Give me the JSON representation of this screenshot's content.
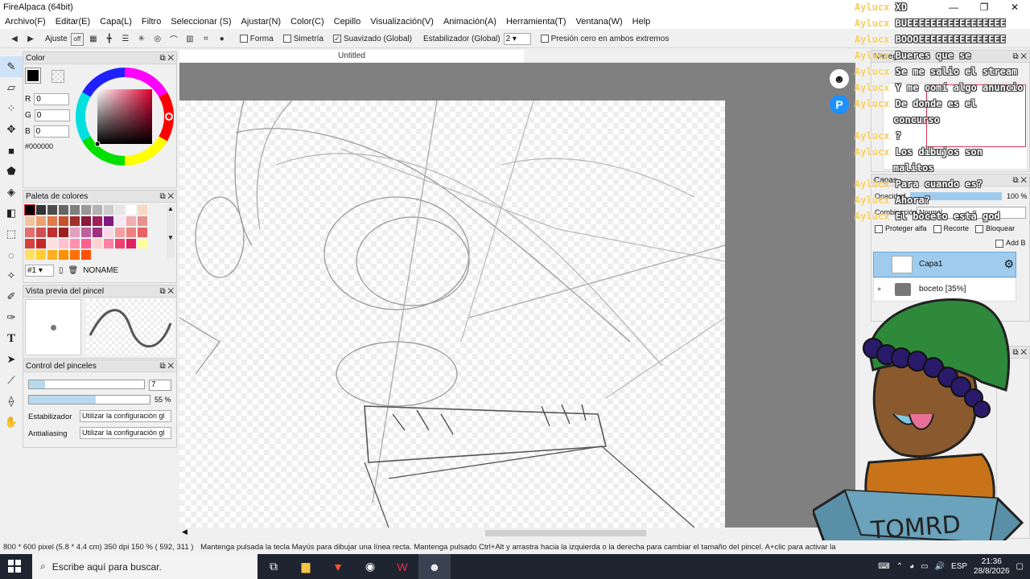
{
  "window": {
    "title": "FireAlpaca (64bit)",
    "controls": [
      "—",
      "❐",
      "✕"
    ]
  },
  "menu": [
    "Archivo(F)",
    "Editar(E)",
    "Capa(L)",
    "Filtro",
    "Seleccionar (S)",
    "Ajustar(N)",
    "Color(C)",
    "Cepillo",
    "Visualización(V)",
    "Animación(A)",
    "Herramienta(T)",
    "Ventana(W)",
    "Help"
  ],
  "toolbar": {
    "ajuste": "Ajuste",
    "forma": "Forma",
    "simetria": "Simetría",
    "suavizado": "Suavizado (Global)",
    "estabilizador": "Estabilizador (Global)",
    "estabilizador_value": "2",
    "presion": "Presión cero en ambos extremos"
  },
  "color_panel": {
    "title": "Color",
    "r": "0",
    "g": "0",
    "b": "0",
    "r_label": "R",
    "g_label": "G",
    "b_label": "B",
    "hex": "#000000"
  },
  "palette": {
    "title": "Paleta de colores",
    "index": "#1",
    "name": "NONAME",
    "colors": [
      "#000000",
      "#333333",
      "#4d4d4d",
      "#666666",
      "#808080",
      "#999999",
      "#b3b3b3",
      "#cccccc",
      "#e6e6e6",
      "#ffffff",
      "#f7d9c4",
      "#f2c2a0",
      "#eda070",
      "#e07a4a",
      "#c8502a",
      "#a0302a",
      "#8b1a3a",
      "#a0205a",
      "#801880",
      "#f5e6f5",
      "#f0b0b0",
      "#e89090",
      "#e07070",
      "#d05050",
      "#c03030",
      "#a02020",
      "#e0a0c0",
      "#c060a0",
      "#a03080",
      "#f8d8e8",
      "#f5a0a0",
      "#f08080",
      "#e86060",
      "#d84040",
      "#c82828",
      "#ffe0e0",
      "#ffc0d0",
      "#ff90b0",
      "#ff6090",
      "#ffd0d0",
      "#ff80a0",
      "#f04070",
      "#e02060",
      "#ffffa0",
      "#ffe060",
      "#ffd030",
      "#ffb020",
      "#ff9000",
      "#ff7000",
      "#ff5000"
    ]
  },
  "brush_preview": {
    "title": "Vista previa del pincel"
  },
  "brush_control": {
    "title": "Control del pinceles",
    "size": "7",
    "opacity": "55 %",
    "size_fill": 0.14,
    "opacity_fill": 0.55,
    "stabilizer_label": "Estabilizador",
    "stabilizer_value": "Utilizar la configuración gl",
    "aa_label": "Antialiasing",
    "aa_value": "Utilizar la configuración gl"
  },
  "canvas": {
    "tab": "Untitled"
  },
  "navigator": {
    "title": "Naveg"
  },
  "layers": {
    "title": "Capas",
    "opacity_label": "Opacidad",
    "opacity_value": "100 %",
    "blend_label": "Combinación",
    "blend_value": "Normal",
    "protect": "Proteger alfa",
    "clip": "Recorte",
    "lock": "Bloquear",
    "add": "Add B",
    "items": [
      {
        "name": "Capa1"
      },
      {
        "name": "boceto [35%]"
      }
    ]
  },
  "chat": [
    {
      "user": "Aylucx",
      "msg": "XD"
    },
    {
      "user": "Aylucx",
      "msg": "BUEEEEEEEEEEEEEEEEE"
    },
    {
      "user": "Aylucx",
      "msg": "BOOOEEEEEEEEEEEEEEE"
    },
    {
      "user": "Aylucx",
      "msg": "Bueres que se"
    },
    {
      "user": "Aylucx",
      "msg": "Se me salio el stream"
    },
    {
      "user": "Aylucx",
      "msg": "Y me comí algo anuncio"
    },
    {
      "user": "Aylucx",
      "msg": "De donde es el"
    },
    {
      "user": "",
      "msg": "concurso"
    },
    {
      "user": "Aylucx",
      "msg": "?"
    },
    {
      "user": "Aylucx",
      "msg": "Los dibujos son"
    },
    {
      "user": "",
      "msg": "malitos"
    },
    {
      "user": "Aylucx",
      "msg": "Para cuando es?"
    },
    {
      "user": "Aylucx",
      "msg": "Ahora?"
    },
    {
      "user": "Aylucx",
      "msg": "El boceto está god"
    }
  ],
  "avatar": {
    "label": "TOMRD"
  },
  "status": {
    "size": "800 * 600 pixel",
    "dims": "(5.8 * 4.4 cm)",
    "dpi": "350 dpi",
    "zoom": "150 %",
    "coords": "( 592, 311 )",
    "hint": "Mantenga pulsada la tecla Mayús para dibujar una línea recta. Mantenga pulsado Ctrl+Alt y arrastra hacia la izquierda o la derecha para cambiar el tamaño del pincel. A+clic para activar la"
  },
  "taskbar": {
    "search": "Escribe aquí para buscar.",
    "lang": "ESP",
    "time": "21:36",
    "date": "28/8/2026"
  }
}
